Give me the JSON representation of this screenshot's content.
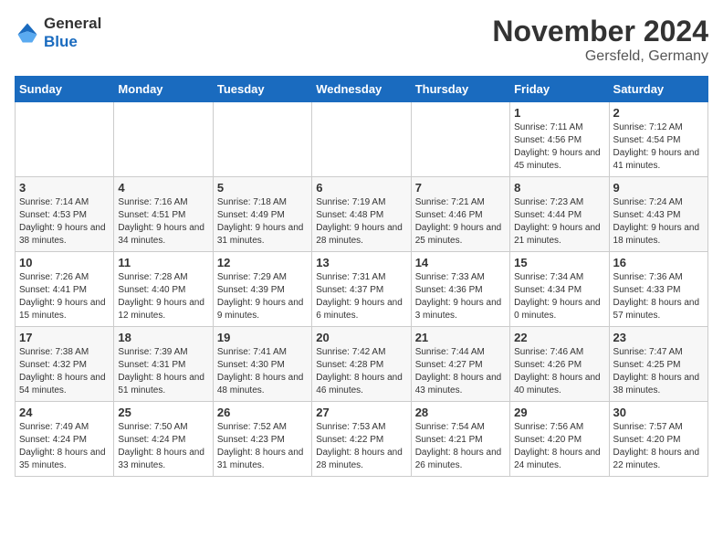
{
  "logo": {
    "general": "General",
    "blue": "Blue"
  },
  "title": "November 2024",
  "location": "Gersfeld, Germany",
  "days_of_week": [
    "Sunday",
    "Monday",
    "Tuesday",
    "Wednesday",
    "Thursday",
    "Friday",
    "Saturday"
  ],
  "weeks": [
    [
      {
        "day": "",
        "sunrise": "",
        "sunset": "",
        "daylight": ""
      },
      {
        "day": "",
        "sunrise": "",
        "sunset": "",
        "daylight": ""
      },
      {
        "day": "",
        "sunrise": "",
        "sunset": "",
        "daylight": ""
      },
      {
        "day": "",
        "sunrise": "",
        "sunset": "",
        "daylight": ""
      },
      {
        "day": "",
        "sunrise": "",
        "sunset": "",
        "daylight": ""
      },
      {
        "day": "1",
        "sunrise": "Sunrise: 7:11 AM",
        "sunset": "Sunset: 4:56 PM",
        "daylight": "Daylight: 9 hours and 45 minutes."
      },
      {
        "day": "2",
        "sunrise": "Sunrise: 7:12 AM",
        "sunset": "Sunset: 4:54 PM",
        "daylight": "Daylight: 9 hours and 41 minutes."
      }
    ],
    [
      {
        "day": "3",
        "sunrise": "Sunrise: 7:14 AM",
        "sunset": "Sunset: 4:53 PM",
        "daylight": "Daylight: 9 hours and 38 minutes."
      },
      {
        "day": "4",
        "sunrise": "Sunrise: 7:16 AM",
        "sunset": "Sunset: 4:51 PM",
        "daylight": "Daylight: 9 hours and 34 minutes."
      },
      {
        "day": "5",
        "sunrise": "Sunrise: 7:18 AM",
        "sunset": "Sunset: 4:49 PM",
        "daylight": "Daylight: 9 hours and 31 minutes."
      },
      {
        "day": "6",
        "sunrise": "Sunrise: 7:19 AM",
        "sunset": "Sunset: 4:48 PM",
        "daylight": "Daylight: 9 hours and 28 minutes."
      },
      {
        "day": "7",
        "sunrise": "Sunrise: 7:21 AM",
        "sunset": "Sunset: 4:46 PM",
        "daylight": "Daylight: 9 hours and 25 minutes."
      },
      {
        "day": "8",
        "sunrise": "Sunrise: 7:23 AM",
        "sunset": "Sunset: 4:44 PM",
        "daylight": "Daylight: 9 hours and 21 minutes."
      },
      {
        "day": "9",
        "sunrise": "Sunrise: 7:24 AM",
        "sunset": "Sunset: 4:43 PM",
        "daylight": "Daylight: 9 hours and 18 minutes."
      }
    ],
    [
      {
        "day": "10",
        "sunrise": "Sunrise: 7:26 AM",
        "sunset": "Sunset: 4:41 PM",
        "daylight": "Daylight: 9 hours and 15 minutes."
      },
      {
        "day": "11",
        "sunrise": "Sunrise: 7:28 AM",
        "sunset": "Sunset: 4:40 PM",
        "daylight": "Daylight: 9 hours and 12 minutes."
      },
      {
        "day": "12",
        "sunrise": "Sunrise: 7:29 AM",
        "sunset": "Sunset: 4:39 PM",
        "daylight": "Daylight: 9 hours and 9 minutes."
      },
      {
        "day": "13",
        "sunrise": "Sunrise: 7:31 AM",
        "sunset": "Sunset: 4:37 PM",
        "daylight": "Daylight: 9 hours and 6 minutes."
      },
      {
        "day": "14",
        "sunrise": "Sunrise: 7:33 AM",
        "sunset": "Sunset: 4:36 PM",
        "daylight": "Daylight: 9 hours and 3 minutes."
      },
      {
        "day": "15",
        "sunrise": "Sunrise: 7:34 AM",
        "sunset": "Sunset: 4:34 PM",
        "daylight": "Daylight: 9 hours and 0 minutes."
      },
      {
        "day": "16",
        "sunrise": "Sunrise: 7:36 AM",
        "sunset": "Sunset: 4:33 PM",
        "daylight": "Daylight: 8 hours and 57 minutes."
      }
    ],
    [
      {
        "day": "17",
        "sunrise": "Sunrise: 7:38 AM",
        "sunset": "Sunset: 4:32 PM",
        "daylight": "Daylight: 8 hours and 54 minutes."
      },
      {
        "day": "18",
        "sunrise": "Sunrise: 7:39 AM",
        "sunset": "Sunset: 4:31 PM",
        "daylight": "Daylight: 8 hours and 51 minutes."
      },
      {
        "day": "19",
        "sunrise": "Sunrise: 7:41 AM",
        "sunset": "Sunset: 4:30 PM",
        "daylight": "Daylight: 8 hours and 48 minutes."
      },
      {
        "day": "20",
        "sunrise": "Sunrise: 7:42 AM",
        "sunset": "Sunset: 4:28 PM",
        "daylight": "Daylight: 8 hours and 46 minutes."
      },
      {
        "day": "21",
        "sunrise": "Sunrise: 7:44 AM",
        "sunset": "Sunset: 4:27 PM",
        "daylight": "Daylight: 8 hours and 43 minutes."
      },
      {
        "day": "22",
        "sunrise": "Sunrise: 7:46 AM",
        "sunset": "Sunset: 4:26 PM",
        "daylight": "Daylight: 8 hours and 40 minutes."
      },
      {
        "day": "23",
        "sunrise": "Sunrise: 7:47 AM",
        "sunset": "Sunset: 4:25 PM",
        "daylight": "Daylight: 8 hours and 38 minutes."
      }
    ],
    [
      {
        "day": "24",
        "sunrise": "Sunrise: 7:49 AM",
        "sunset": "Sunset: 4:24 PM",
        "daylight": "Daylight: 8 hours and 35 minutes."
      },
      {
        "day": "25",
        "sunrise": "Sunrise: 7:50 AM",
        "sunset": "Sunset: 4:24 PM",
        "daylight": "Daylight: 8 hours and 33 minutes."
      },
      {
        "day": "26",
        "sunrise": "Sunrise: 7:52 AM",
        "sunset": "Sunset: 4:23 PM",
        "daylight": "Daylight: 8 hours and 31 minutes."
      },
      {
        "day": "27",
        "sunrise": "Sunrise: 7:53 AM",
        "sunset": "Sunset: 4:22 PM",
        "daylight": "Daylight: 8 hours and 28 minutes."
      },
      {
        "day": "28",
        "sunrise": "Sunrise: 7:54 AM",
        "sunset": "Sunset: 4:21 PM",
        "daylight": "Daylight: 8 hours and 26 minutes."
      },
      {
        "day": "29",
        "sunrise": "Sunrise: 7:56 AM",
        "sunset": "Sunset: 4:20 PM",
        "daylight": "Daylight: 8 hours and 24 minutes."
      },
      {
        "day": "30",
        "sunrise": "Sunrise: 7:57 AM",
        "sunset": "Sunset: 4:20 PM",
        "daylight": "Daylight: 8 hours and 22 minutes."
      }
    ]
  ]
}
